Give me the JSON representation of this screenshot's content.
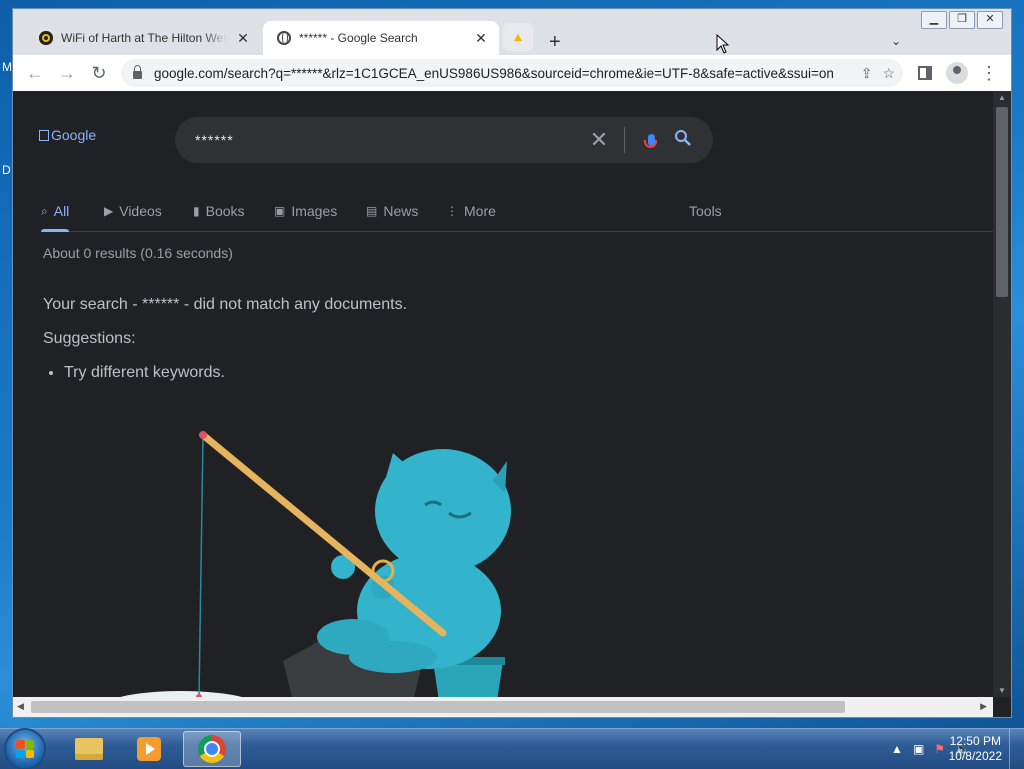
{
  "desktop": {
    "fragment_top": "M",
    "fragment_mid": "D"
  },
  "window": {
    "controls": [
      "minimize",
      "restore",
      "close"
    ]
  },
  "tabs": [
    {
      "title": "WiFi of Harth at The Hilton Westwood",
      "favicon": "wifi-icon",
      "close": "✕"
    },
    {
      "title": "****** - Google Search",
      "favicon": "globe-icon",
      "close": "✕"
    }
  ],
  "toolbar": {
    "new_tab": "+",
    "tab_search": "⌄",
    "back": "←",
    "forward": "→",
    "reload": "↻",
    "url": "google.com/search?q=******&rlz=1C1GCEA_enUS986US986&sourceid=chrome&ie=UTF-8&safe=active&ssui=on",
    "share": "⇪",
    "bookmark": "☆",
    "menu": "⋮"
  },
  "page": {
    "logo_alt": "Google",
    "query": "******",
    "nav": [
      {
        "label": "All",
        "icon": "search-icon",
        "glyph": "⌕"
      },
      {
        "label": "Videos",
        "icon": "video-icon",
        "glyph": "▶"
      },
      {
        "label": "Books",
        "icon": "book-icon",
        "glyph": "▮"
      },
      {
        "label": "Images",
        "icon": "image-icon",
        "glyph": "▣"
      },
      {
        "label": "News",
        "icon": "news-icon",
        "glyph": "▤"
      },
      {
        "label": "More",
        "icon": "more-icon",
        "glyph": "⋮"
      }
    ],
    "tools": "Tools",
    "stats": "About 0 results (0.16 seconds)",
    "no_match": "Your search - ****** - did not match any documents.",
    "suggestions_title": "Suggestions:",
    "suggestions": [
      "Try different keywords."
    ]
  },
  "taskbar": {
    "apps": [
      "file-explorer",
      "media-player",
      "chrome"
    ],
    "time": "12:50 PM",
    "date": "10/8/2022"
  },
  "colors": {
    "page_bg": "#202124",
    "accent": "#8ab4f8",
    "text": "#bdc1c6",
    "muted": "#9aa0a6"
  }
}
